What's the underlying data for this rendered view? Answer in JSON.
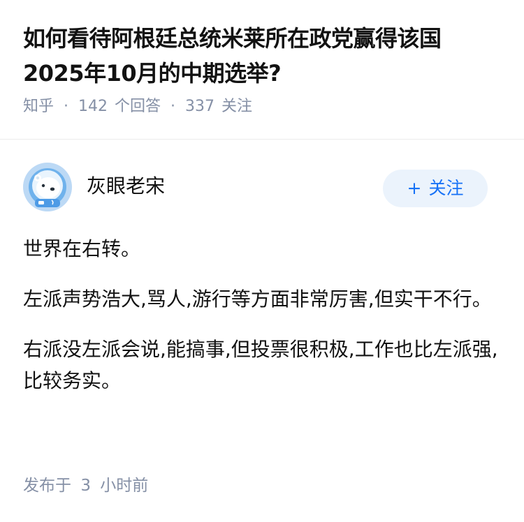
{
  "question": {
    "title": "如何看待阿根廷总统米莱所在政党赢得该国 2025年10月的中期选举?",
    "source": "知乎",
    "answer_count": "142",
    "answer_label": "个回答",
    "follower_count": "337",
    "follower_label": "关注"
  },
  "author": {
    "name": "灰眼老宋",
    "avatar_icon": "polar-bear-astronaut-avatar",
    "follow_plus": "+",
    "follow_label": "关注"
  },
  "answer": {
    "paragraphs": [
      "世界在右转。",
      "左派声势浩大,骂人,游行等方面非常厉害,但实干不行。",
      "右派没左派会说,能搞事,但投票很积极,工作也比左派强,比较务实。"
    ]
  },
  "footer": {
    "published_label": "发布于",
    "time_value": "3",
    "time_unit": "小时前"
  },
  "colors": {
    "text": "#121212",
    "meta": "#8590a6",
    "accent": "#1772f6",
    "follow_bg": "#ebf3fc",
    "divider": "#ebebeb"
  }
}
